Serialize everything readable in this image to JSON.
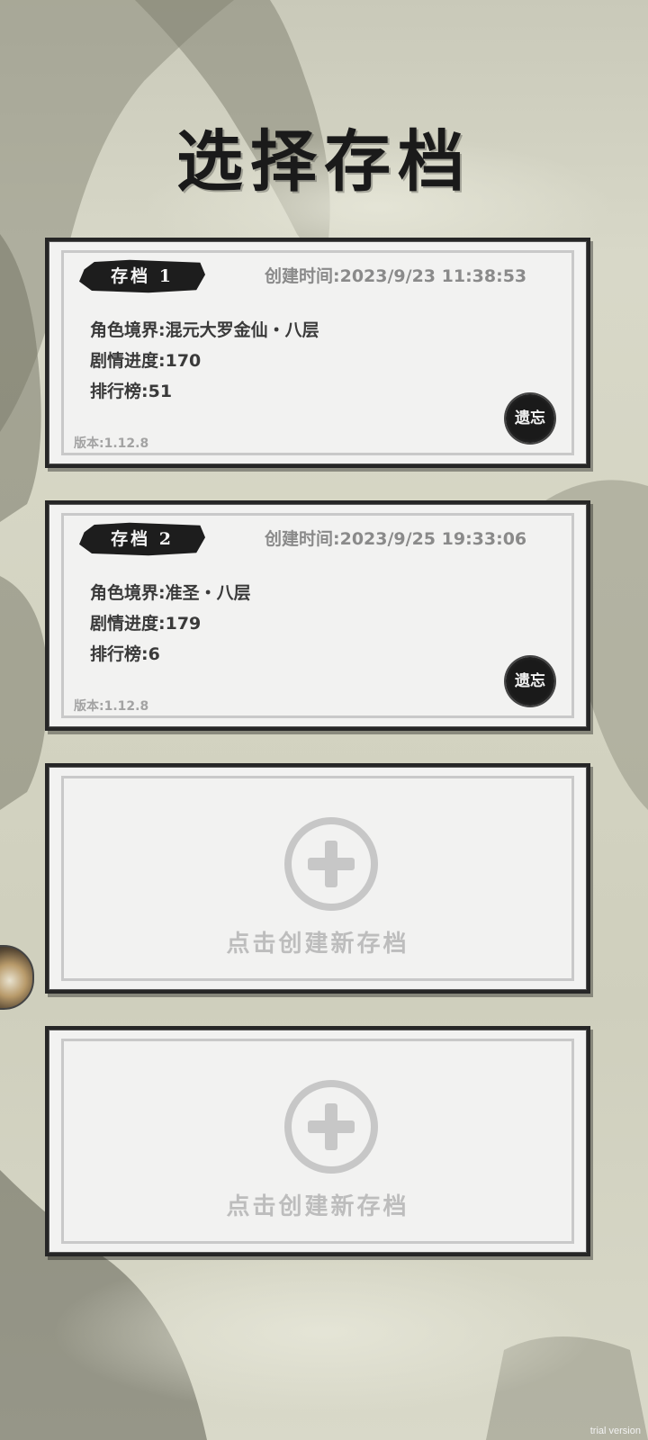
{
  "page": {
    "title": "选择存档"
  },
  "slots": [
    {
      "label": "存档 1",
      "created": "创建时间:2023/9/23 11:38:53",
      "realm": "角色境界:混元大罗金仙・八层",
      "progress": "剧情进度:170",
      "rank": "排行榜:51",
      "version": "版本:1.12.8",
      "forget_label": "遗忘"
    },
    {
      "label": "存档 2",
      "created": "创建时间:2023/9/25 19:33:06",
      "realm": "角色境界:准圣・八层",
      "progress": "剧情进度:179",
      "rank": "排行榜:6",
      "version": "版本:1.12.8",
      "forget_label": "遗忘"
    }
  ],
  "empty_slots": [
    {
      "label": "点击创建新存档",
      "icon": "plus-circle-icon"
    },
    {
      "label": "点击创建新存档",
      "icon": "plus-circle-icon"
    }
  ],
  "watermark": "trial version",
  "colors": {
    "ink": "#1a1a1a",
    "paper": "#f2f2f1",
    "muted": "#8a8a8a"
  }
}
